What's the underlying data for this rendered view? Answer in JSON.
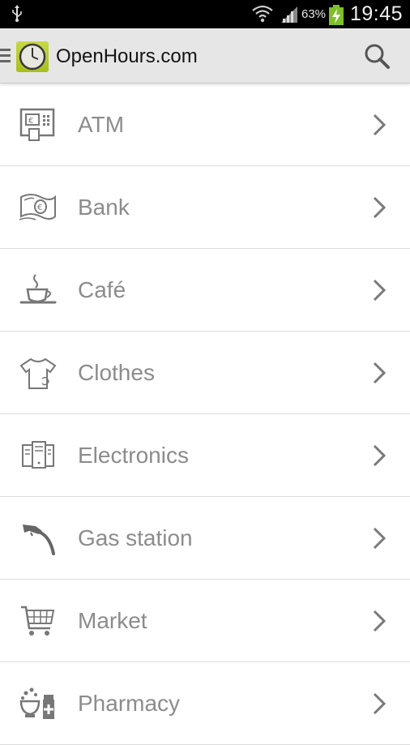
{
  "status_bar": {
    "battery_percent": "63%",
    "time": "19:45",
    "icons": [
      "usb-icon",
      "wifi-icon",
      "signal-icon",
      "battery-charging-icon"
    ]
  },
  "action_bar": {
    "title": "OpenHours.com",
    "icons": [
      "drawer-icon",
      "clock-logo-icon",
      "search-icon"
    ],
    "logo_color": "#b5c92a"
  },
  "categories": [
    {
      "label": "ATM",
      "icon": "atm-icon"
    },
    {
      "label": "Bank",
      "icon": "banknote-icon"
    },
    {
      "label": "Café",
      "icon": "coffee-cup-icon"
    },
    {
      "label": "Clothes",
      "icon": "tshirt-icon"
    },
    {
      "label": "Electronics",
      "icon": "devices-icon"
    },
    {
      "label": "Gas station",
      "icon": "fuel-nozzle-icon"
    },
    {
      "label": "Market",
      "icon": "shopping-cart-icon"
    },
    {
      "label": "Pharmacy",
      "icon": "mortar-pestle-icon"
    }
  ]
}
